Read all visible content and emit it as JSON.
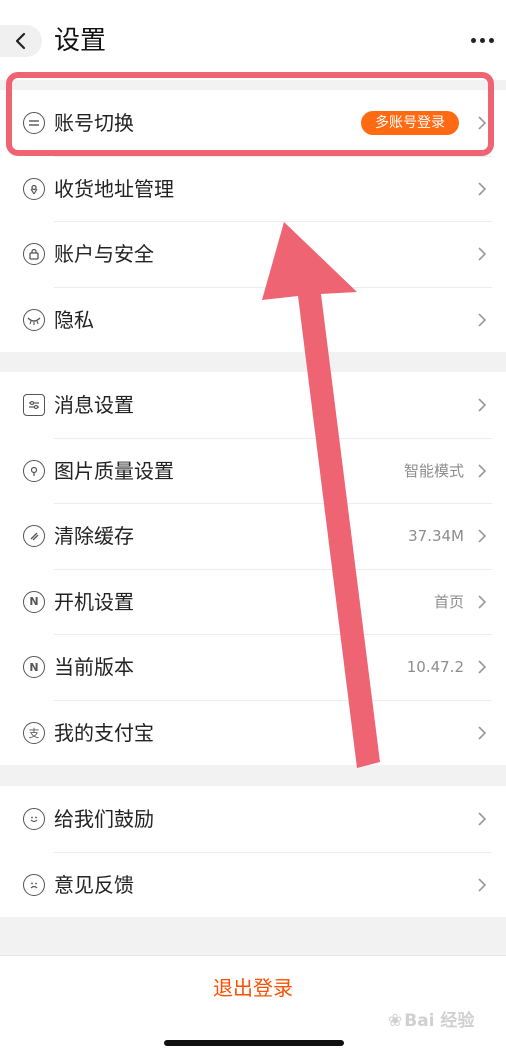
{
  "header": {
    "title": "设置"
  },
  "groups": [
    {
      "items": [
        {
          "label": "账号切换",
          "badge": "多账号登录",
          "icon": "switch-icon"
        },
        {
          "label": "收货地址管理",
          "icon": "location-pin-icon"
        },
        {
          "label": "账户与安全",
          "icon": "lock-icon"
        },
        {
          "label": "隐私",
          "icon": "closed-eye-icon"
        }
      ]
    },
    {
      "items": [
        {
          "label": "消息设置",
          "icon": "sliders-icon"
        },
        {
          "label": "图片质量设置",
          "value": "智能模式",
          "icon": "flower-icon"
        },
        {
          "label": "清除缓存",
          "value": "37.34M",
          "icon": "broom-icon"
        },
        {
          "label": "开机设置",
          "value": "首页",
          "icon": "n-circle-icon"
        },
        {
          "label": "当前版本",
          "value": "10.47.2",
          "icon": "n-circle-icon"
        },
        {
          "label": "我的支付宝",
          "icon": "alipay-icon"
        }
      ]
    },
    {
      "items": [
        {
          "label": "给我们鼓励",
          "icon": "smile-icon"
        },
        {
          "label": "意见反馈",
          "icon": "sad-face-icon"
        }
      ]
    }
  ],
  "footer": {
    "logout_label": "退出登录"
  },
  "watermark": {
    "text": "Bai 经验"
  },
  "colors": {
    "accent": "#ff5000",
    "badge_bg": "#ff6a13",
    "annotation": "#ee6473"
  }
}
